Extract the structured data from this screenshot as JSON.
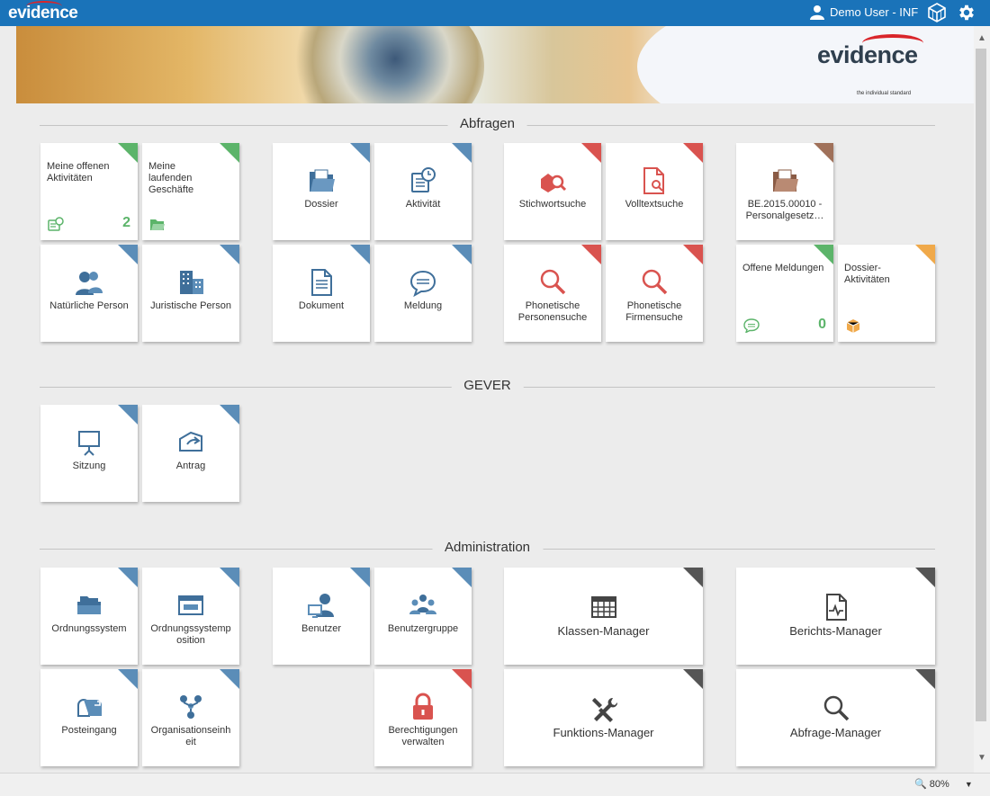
{
  "header": {
    "logo": "evidence",
    "user": "Demo User - INF",
    "icons": [
      "user-icon",
      "cube-icon",
      "gear-icon"
    ]
  },
  "banner": {
    "brand": "evidence",
    "tagline": "the individual standard"
  },
  "sections": {
    "abfragen": "Abfragen",
    "gever": "GEVER",
    "administration": "Administration"
  },
  "tiles": {
    "meine_offenen": {
      "label": "Meine offenen Aktivitäten",
      "count": "2"
    },
    "meine_laufenden": {
      "label": "Meine laufenden Geschäfte"
    },
    "dossier": {
      "label": "Dossier"
    },
    "aktivitaet": {
      "label": "Aktivität"
    },
    "stichwortsuche": {
      "label": "Stichwortsuche"
    },
    "volltextsuche": {
      "label": "Volltextsuche"
    },
    "be_dossier": {
      "label": "BE.2015.00010 - Personalgesetz…"
    },
    "natuerliche_person": {
      "label": "Natürliche Person"
    },
    "juristische_person": {
      "label": "Juristische Person"
    },
    "dokument": {
      "label": "Dokument"
    },
    "meldung": {
      "label": "Meldung"
    },
    "phonetische_personensuche": {
      "label": "Phonetische Personensuche"
    },
    "phonetische_firmensuche": {
      "label": "Phonetische Firmensuche"
    },
    "offene_meldungen": {
      "label": "Offene Meldungen",
      "count": "0"
    },
    "dossier_aktivitaeten": {
      "label": "Dossier-Aktivitäten"
    },
    "sitzung": {
      "label": "Sitzung"
    },
    "antrag": {
      "label": "Antrag"
    },
    "ordnungssystem": {
      "label": "Ordnungssystem"
    },
    "ordnungssystemposition": {
      "label": "Ordnungssystemp osition"
    },
    "benutzer": {
      "label": "Benutzer"
    },
    "benutzergruppe": {
      "label": "Benutzergruppe"
    },
    "klassen_manager": {
      "label": "Klassen-Manager"
    },
    "berichts_manager": {
      "label": "Berichts-Manager"
    },
    "posteingang": {
      "label": "Posteingang"
    },
    "organisationseinheit": {
      "label": "Organisationseinh eit"
    },
    "berechtigungen": {
      "label": "Berechtigungen verwalten"
    },
    "funktions_manager": {
      "label": "Funktions-Manager"
    },
    "abfrage_manager": {
      "label": "Abfrage-Manager"
    }
  },
  "statusbar": {
    "zoom": "80%"
  },
  "colors": {
    "header": "#1a73b9",
    "blue": "#5b8db8",
    "red": "#d9534f",
    "green": "#5cb46a",
    "brown": "#a0715a",
    "orange": "#f0a94a",
    "dark": "#555555"
  }
}
